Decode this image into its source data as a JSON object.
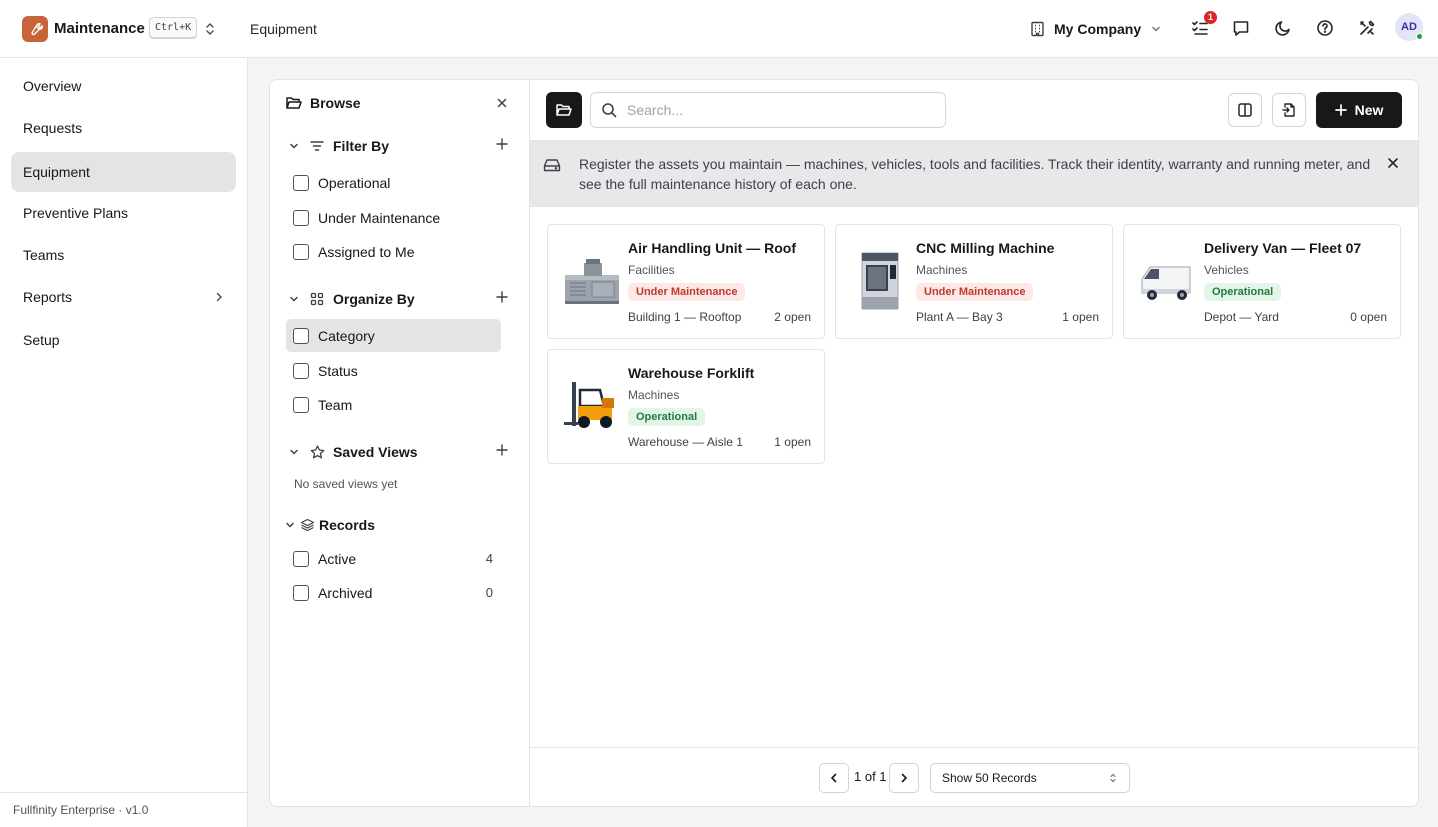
{
  "header": {
    "app_name": "Maintenance",
    "shortcut": "Ctrl+K",
    "breadcrumb": "Equipment",
    "company": "My Company",
    "notification_count": "1",
    "avatar_initials": "AD"
  },
  "sidebar": {
    "items": [
      {
        "label": "Overview"
      },
      {
        "label": "Requests"
      },
      {
        "label": "Equipment"
      },
      {
        "label": "Preventive Plans"
      },
      {
        "label": "Teams"
      },
      {
        "label": "Reports"
      },
      {
        "label": "Setup"
      }
    ],
    "active": "Equipment",
    "footer": "Fullfinity Enterprise · v1.0"
  },
  "browse": {
    "title": "Browse",
    "filter_by": {
      "label": "Filter By",
      "options": [
        "Operational",
        "Under Maintenance",
        "Assigned to Me"
      ]
    },
    "organize_by": {
      "label": "Organize By",
      "options": [
        "Category",
        "Status",
        "Team"
      ]
    },
    "saved_views": {
      "label": "Saved Views",
      "empty": "No saved views yet"
    },
    "records": {
      "label": "Records",
      "options": [
        {
          "label": "Active",
          "count": "4"
        },
        {
          "label": "Archived",
          "count": "0"
        }
      ]
    }
  },
  "toolbar": {
    "search_placeholder": "Search...",
    "new_label": "New"
  },
  "banner": {
    "text": "Register the assets you maintain — machines, vehicles, tools and facilities. Track their identity, warranty and running meter, and see the full maintenance history of each one."
  },
  "equipment": [
    {
      "name": "Air Handling Unit — Roof",
      "category": "Facilities",
      "status": "Under Maintenance",
      "location": "Building 1 — Rooftop",
      "open": "2 open",
      "image": "air-handling-unit-image"
    },
    {
      "name": "CNC Milling Machine",
      "category": "Machines",
      "status": "Under Maintenance",
      "location": "Plant A — Bay 3",
      "open": "1 open",
      "image": "cnc-machine-image"
    },
    {
      "name": "Delivery Van — Fleet 07",
      "category": "Vehicles",
      "status": "Operational",
      "location": "Depot — Yard",
      "open": "0 open",
      "image": "delivery-van-image"
    },
    {
      "name": "Warehouse Forklift",
      "category": "Machines",
      "status": "Operational",
      "location": "Warehouse — Aisle 1",
      "open": "1 open",
      "image": "forklift-image"
    }
  ],
  "pagination": {
    "page_text": "1 of 1",
    "page_size": "Show 50 Records"
  },
  "colors": {
    "accent": "#18181b",
    "brand": "#c8643c",
    "maintenance_badge": "#c0392b",
    "operational_badge": "#237a3b"
  }
}
